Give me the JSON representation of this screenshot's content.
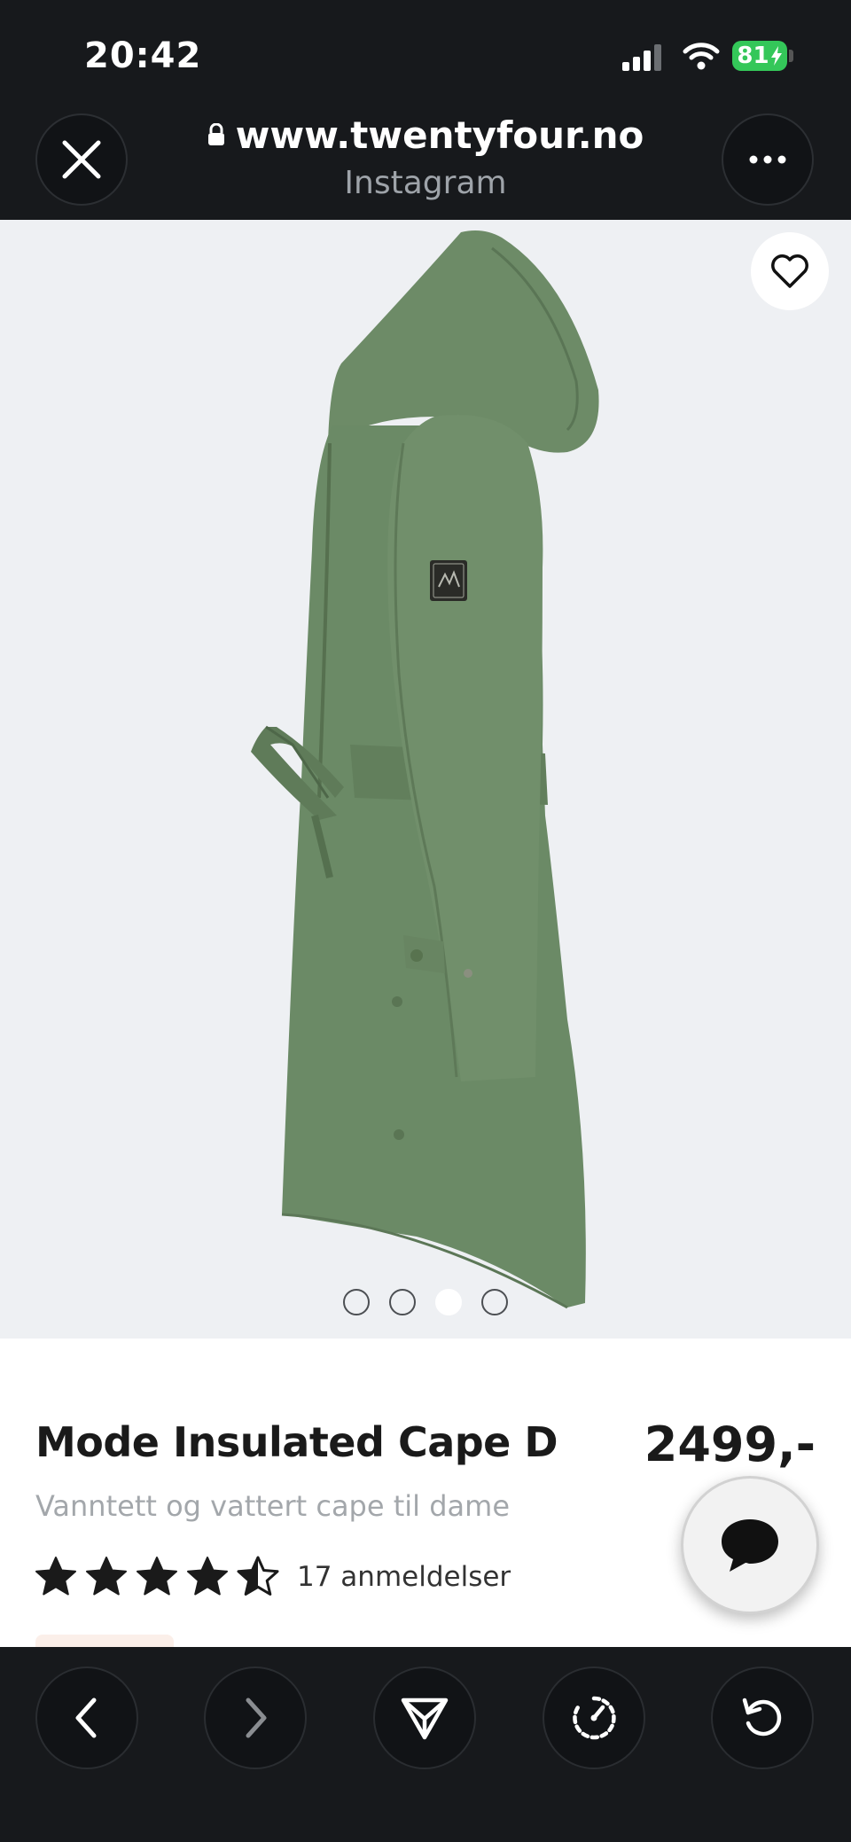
{
  "status_bar": {
    "time": "20:42",
    "battery": "81",
    "icons": [
      "cellular-signal-icon",
      "wifi-icon",
      "battery-charging-icon"
    ]
  },
  "browser": {
    "url": "www.twentyfour.no",
    "source": "Instagram",
    "close_icon": "close-icon",
    "more_icon": "more-icon"
  },
  "gallery": {
    "image_count": 4,
    "active_index": 2,
    "favorite_icon": "heart-icon"
  },
  "product": {
    "name": "Mode Insulated Cape D",
    "price": "2499,-",
    "subtitle": "Vanntett og vattert cape til dame",
    "rating": 4.5,
    "rating_max": 5,
    "reviews": "17 anmeldelser"
  },
  "toolbar": {
    "items": [
      "back-icon",
      "forward-icon",
      "share-icon",
      "speed-icon",
      "reload-icon"
    ]
  },
  "colors": {
    "background_dark": "#17191c",
    "jacket_green": "#6b8a66",
    "battery_green": "#34c759",
    "image_background": "#eef0f3"
  }
}
